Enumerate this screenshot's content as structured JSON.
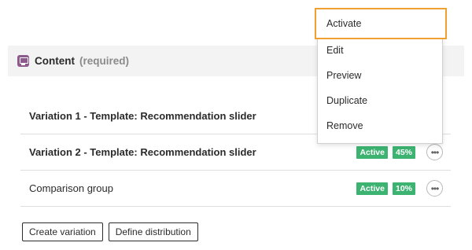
{
  "section": {
    "title": "Content",
    "required": "(required)"
  },
  "variations": [
    {
      "label": "Variation 1 - Template: Recommendation slider",
      "status": "",
      "share": ""
    },
    {
      "label": "Variation 2 - Template: Recommendation slider",
      "status": "Active",
      "share": "45%"
    },
    {
      "label": "Comparison group",
      "status": "Active",
      "share": "10%"
    }
  ],
  "buttons": {
    "create": "Create variation",
    "define": "Define distribution"
  },
  "menu": {
    "activate": "Activate",
    "edit": "Edit",
    "preview": "Preview",
    "duplicate": "Duplicate",
    "remove": "Remove"
  },
  "more_glyph": "•••",
  "colors": {
    "accent": "#3cb371",
    "highlight": "#f0a030",
    "content_icon": "#8e5a8e"
  }
}
